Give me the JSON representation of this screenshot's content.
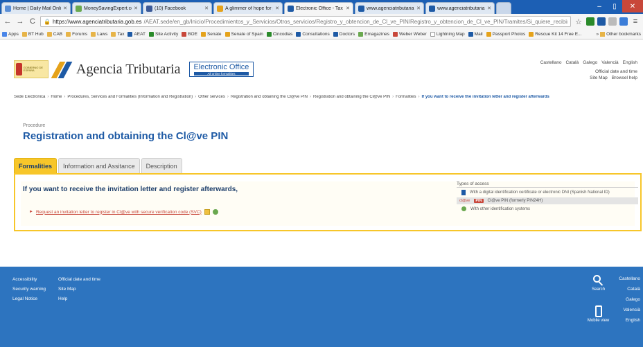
{
  "browser": {
    "tabs": [
      {
        "label": "Home | Daily Mail Online",
        "active": false
      },
      {
        "label": "MoneySavingExpert.com",
        "active": false
      },
      {
        "label": "(10) Facebook",
        "active": false
      },
      {
        "label": "A glimmer of hope for pr",
        "active": false
      },
      {
        "label": "Electronic Office - Tax Ag",
        "active": true
      },
      {
        "label": "www.agenciatributaria.es",
        "active": false
      },
      {
        "label": "www.agenciatributaria.es",
        "active": false
      }
    ],
    "window_controls": {
      "minimize": "–",
      "restore": "▯",
      "close": "✕"
    },
    "nav": {
      "back": "←",
      "forward": "→",
      "reload": "C"
    },
    "url_host": "https://www.agenciatributaria.gob.es",
    "url_path": "/AEAT.sede/en_gb/Inicio/Procedimientos_y_Servicios/Otros_servicios/Registro_y_obtencion_de_Cl_ve_PIN/Registro_y_obtencion_de_Cl_ve_PIN/Tramites/Si_quiere_recibir_la_carta_invitacion_para_r",
    "bookmarks": [
      "Apps",
      "BT Hub",
      "CAB",
      "Forums",
      "Laws",
      "Tax",
      "AEAT",
      "Site Activity",
      "BOE",
      "Senate",
      "Senate of Spain",
      "Cincodias",
      "Consultations",
      "Doctors",
      "Emagazines",
      "Weber Weber",
      "Lightning Map",
      "Mail",
      "Passport Photos",
      "Rescue Kit 14 Free E..."
    ],
    "other_bookmarks": "Other bookmarks",
    "colors": {
      "tabbar": "#1c5fb4",
      "toolbar": "#f5f5f5"
    }
  },
  "header": {
    "gov_logo_text": "GOBIERNO DE ESPAÑA",
    "agency_name": "Agencia Tributaria",
    "eo_title": "Electronic Office",
    "eo_subtitle": "All online formalities",
    "languages": [
      "Castellano",
      "Català",
      "Galego",
      "Valencià",
      "English"
    ],
    "util_links": [
      "Official date and time",
      "Site Map",
      "Browsel help"
    ]
  },
  "breadcrumb": {
    "items": [
      "Sede Electrónica",
      "Home",
      "Procedures, Services and Formalities (Information and Registration)",
      "Other services",
      "Registration and obtaining the Cl@ve PIN",
      "Registration and obtaining the Cl@ve PIN",
      "Formalities"
    ],
    "current": "If you want to receive the invitation letter and register afterwards",
    "separator": "›"
  },
  "main": {
    "procedure_label": "Procedure",
    "title": "Registration and obtaining the Cl@ve PIN",
    "tabs": [
      {
        "label": "Formalities",
        "active": true
      },
      {
        "label": "Information and Assitance",
        "active": false
      },
      {
        "label": "Description",
        "active": false
      }
    ],
    "section_title": "If you want to receive the invitation letter and register afterwards,",
    "request_link": "Request an invitation letter to register in Cl@ve with secure verification code (SVC)",
    "access": {
      "title": "Types of access",
      "items": [
        {
          "text": "With a digital identification certificate or electronic DNI (Spanish National ID)",
          "badge": ""
        },
        {
          "text": "Cl@ve PIN (formerly PIN24H)",
          "badge": "PIN"
        },
        {
          "text": "With other identification systems",
          "badge": ""
        }
      ],
      "clave_prefix": "cl@ve"
    },
    "accent": "#f7c62a",
    "brand": "#1e5aa5"
  },
  "footer": {
    "col1": [
      "Accessibility",
      "Security warning",
      "Legal Notice"
    ],
    "col2": [
      "Official date and time",
      "Site Map",
      "Help"
    ],
    "search_label": "Search",
    "mobile_label": "Mobile view",
    "languages": [
      "Castellano",
      "Català",
      "Galego",
      "Valencià",
      "English"
    ],
    "color": "#2d74bf"
  }
}
